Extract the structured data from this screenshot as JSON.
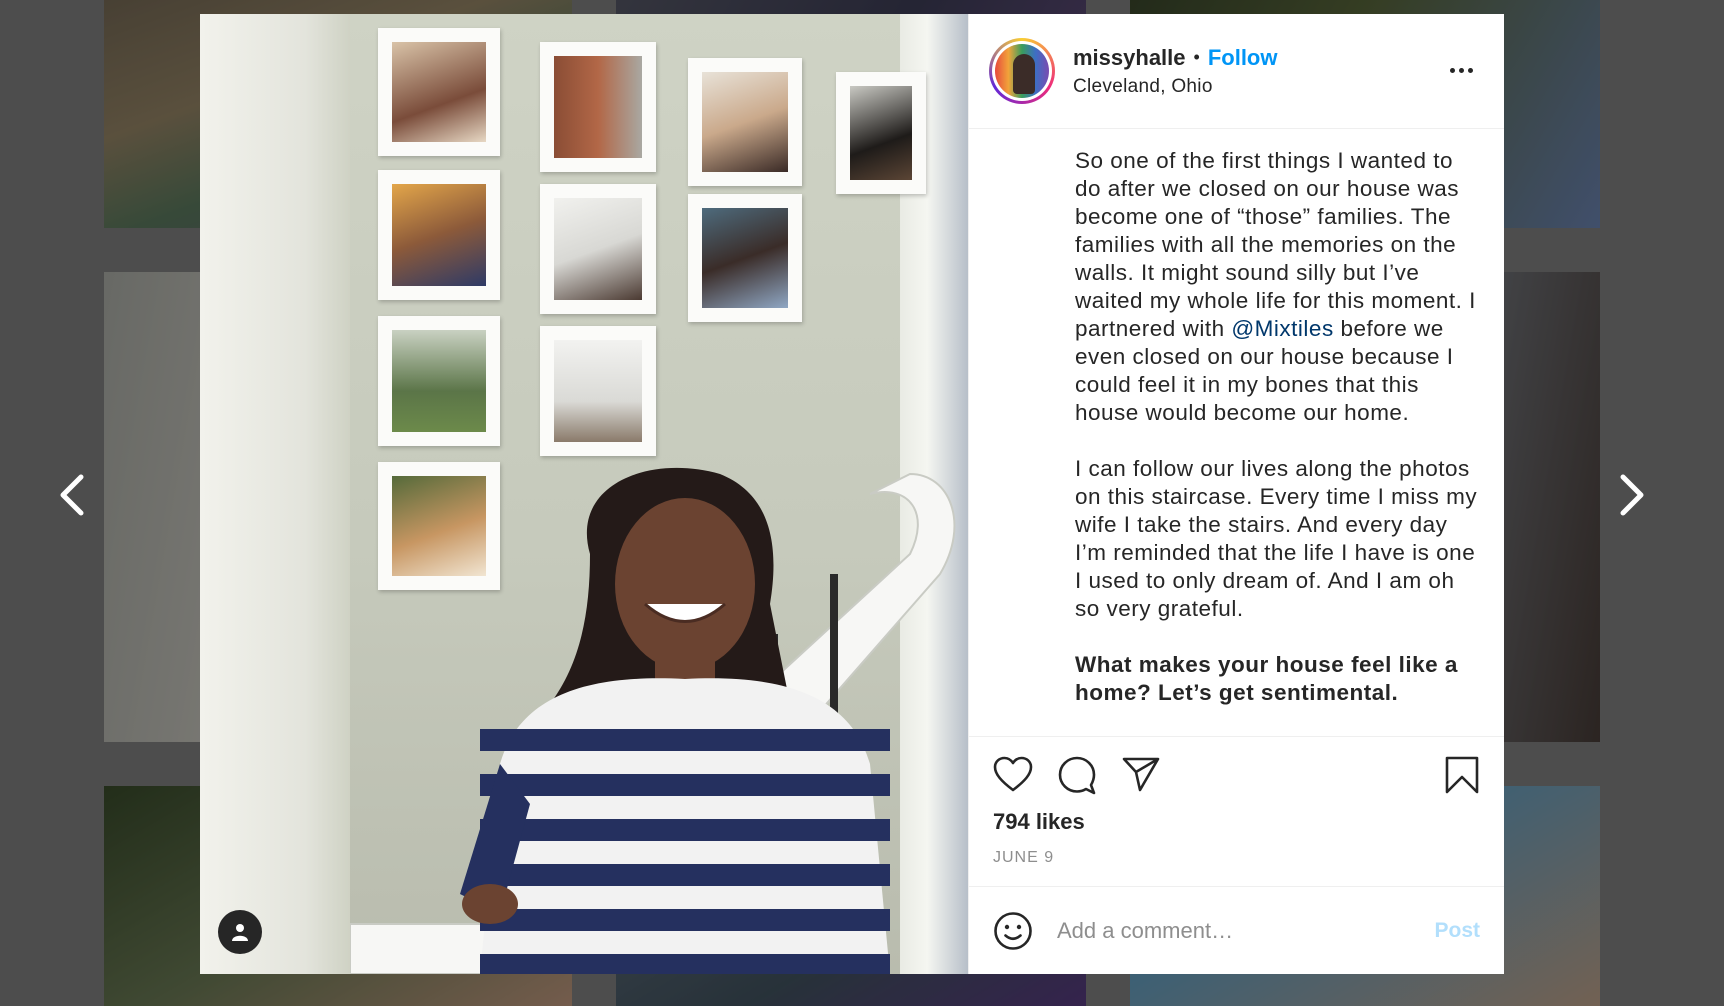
{
  "post": {
    "username": "missyhalle",
    "follow_label": "Follow",
    "separator": "•",
    "location": "Cleveland, Ohio",
    "caption": {
      "p1_a": "So one of the first things I wanted to do after we closed on our house was become one of “those” families. The families with all the memories on the walls. It might sound silly but I’ve waited my whole life for this moment. I partnered with ",
      "mention": "@Mixtiles",
      "p1_b": " before we even closed on our house because I could feel it in my bones that this house would become our home.",
      "p2": "I can follow our lives along the photos on this staircase. Every time I miss my wife I take the stairs. And every day I’m reminded that the life I have is one I used to only dream of. And I am oh so very grateful.",
      "p3": "What makes your house feel like a home? Let’s get sentimental."
    },
    "likes": "794 likes",
    "date": "JUNE 9"
  },
  "comment": {
    "placeholder": "Add a comment…",
    "post_label": "Post"
  },
  "icons": {
    "like": "heart-icon",
    "comment": "comment-icon",
    "share": "paper-plane-icon",
    "save": "bookmark-icon",
    "emoji": "smiley-icon",
    "more": "more-options-icon",
    "prev": "chevron-left-icon",
    "next": "chevron-right-icon",
    "tags": "user-tag-icon"
  },
  "colors": {
    "accent": "#0095f6",
    "post_disabled": "#b2dffc",
    "mention": "#00376b",
    "text": "#262626",
    "muted": "#8e8e8e"
  }
}
